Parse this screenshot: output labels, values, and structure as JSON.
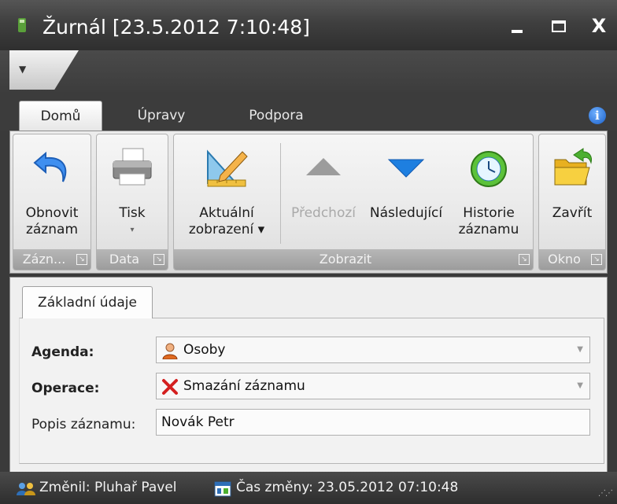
{
  "window": {
    "title": "Žurnál [23.5.2012 7:10:48]",
    "minimize_label": "minimize",
    "maximize_label": "maximize",
    "close_label": "X"
  },
  "ribbon": {
    "tabs": [
      {
        "label": "Domů",
        "active": true
      },
      {
        "label": "Úpravy",
        "active": false
      },
      {
        "label": "Podpora",
        "active": false
      }
    ],
    "info_icon": "info-icon",
    "groups": [
      {
        "label": "Zázn...",
        "buttons": [
          {
            "label_line1": "Obnovit",
            "label_line2": "záznam",
            "icon": "undo-arrow-icon"
          }
        ]
      },
      {
        "label": "Data",
        "buttons": [
          {
            "label_line1": "Tisk",
            "label_line2": "▾",
            "icon": "printer-icon"
          }
        ]
      },
      {
        "label": "Zobrazit",
        "buttons": [
          {
            "label_line1": "Aktuální",
            "label_line2": "zobrazení ▾",
            "icon": "ruler-pencil-icon"
          },
          {
            "label_line1": "Předchozí",
            "label_line2": "",
            "icon": "triangle-up-icon",
            "disabled": true
          },
          {
            "label_line1": "Následující",
            "label_line2": "",
            "icon": "triangle-down-icon"
          },
          {
            "label_line1": "Historie",
            "label_line2": "záznamu",
            "icon": "clock-history-icon"
          }
        ]
      },
      {
        "label": "Okno",
        "buttons": [
          {
            "label_line1": "Zavřít",
            "label_line2": "",
            "icon": "folder-exit-icon"
          }
        ]
      }
    ]
  },
  "content": {
    "tab_label": "Základní údaje",
    "fields": [
      {
        "label": "Agenda:",
        "value": "Osoby",
        "icon": "person-icon",
        "type": "dropdown"
      },
      {
        "label": "Operace:",
        "value": "Smazání záznamu",
        "icon": "red-x-icon",
        "type": "dropdown"
      },
      {
        "label": "Popis záznamu:",
        "value": "Novák Petr",
        "type": "text"
      }
    ]
  },
  "status": {
    "changed_by": "Změnil: Pluhař Pavel",
    "changed_at": "Čas změny: 23.05.2012 07:10:48"
  },
  "colors": {
    "chrome_dark": "#3a3a3a",
    "ribbon_light": "#ececec",
    "group_footer": "#a6a6a6",
    "arrow_blue": "#1e7fe0",
    "close_red": "#d42020"
  }
}
